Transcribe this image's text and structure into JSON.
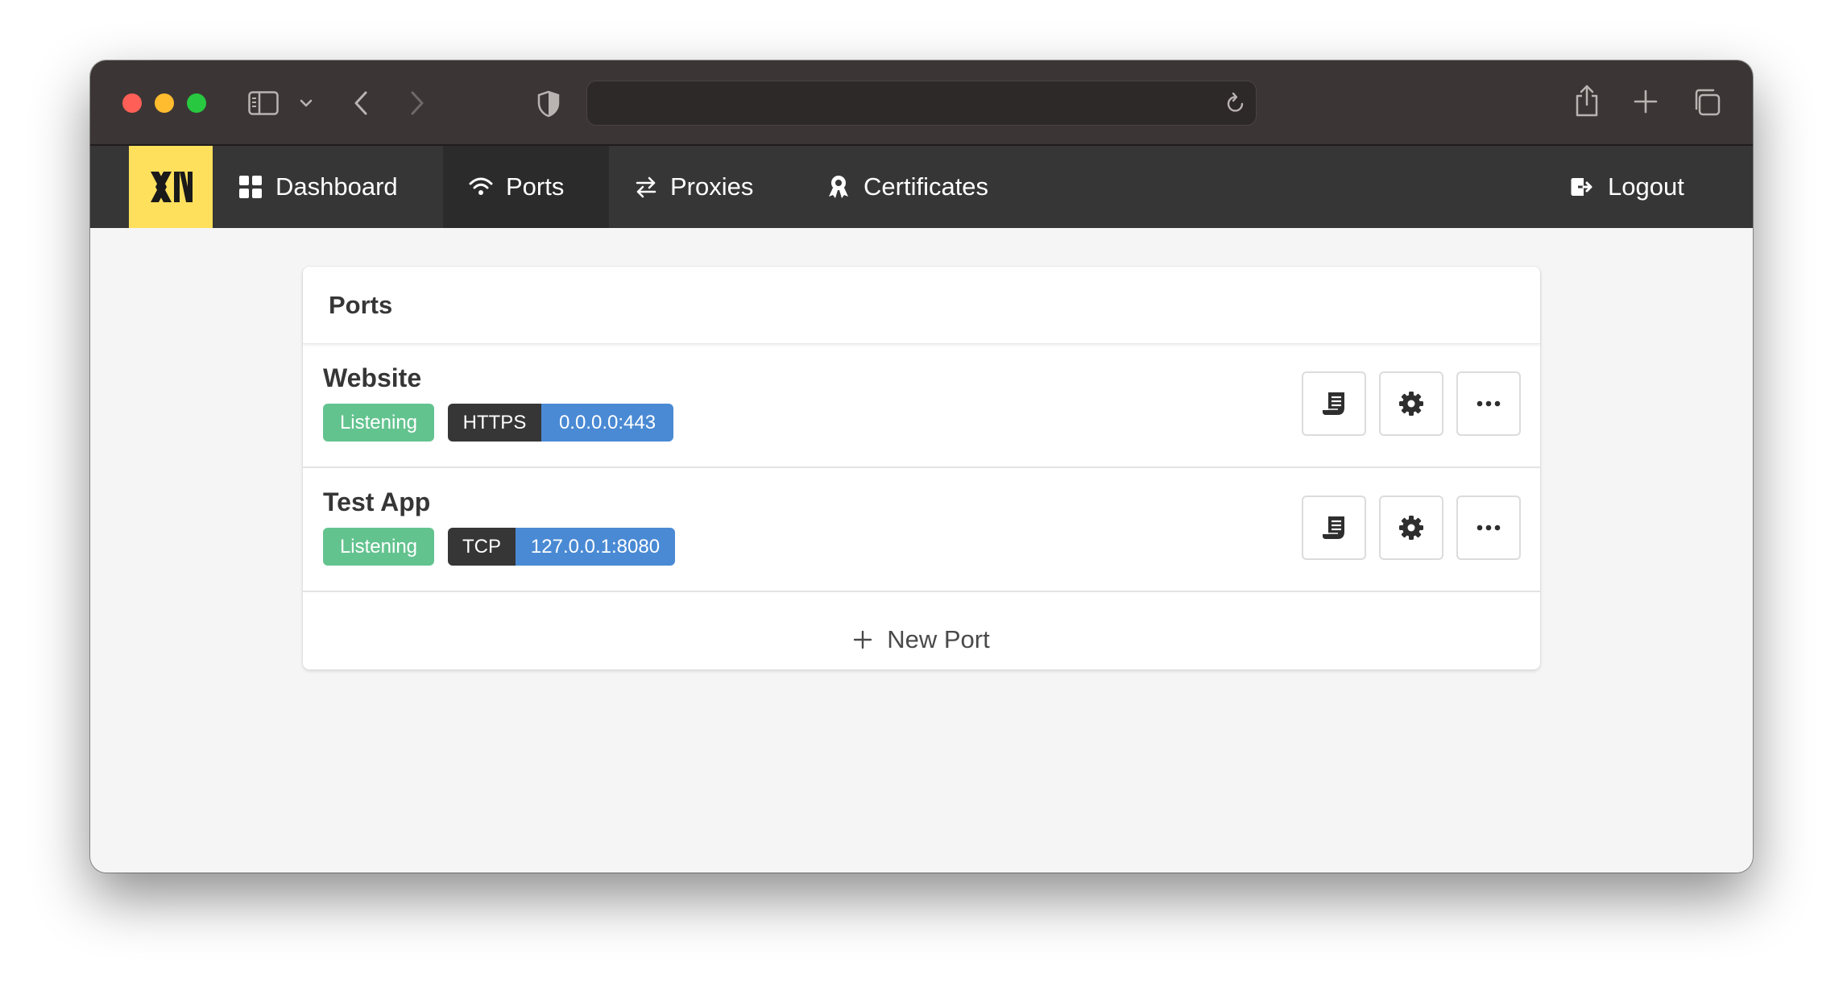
{
  "browser": {
    "address_value": ""
  },
  "nav": {
    "items": [
      {
        "label": "Dashboard",
        "icon": "dashboard-grid-icon"
      },
      {
        "label": "Ports",
        "icon": "wifi-icon",
        "active": true
      },
      {
        "label": "Proxies",
        "icon": "arrows-exchange-icon"
      },
      {
        "label": "Certificates",
        "icon": "certificate-award-icon"
      }
    ],
    "logout_label": "Logout"
  },
  "card": {
    "title": "Ports",
    "ports": [
      {
        "name": "Website",
        "status": "Listening",
        "protocol": "HTTPS",
        "address": "0.0.0.0:443"
      },
      {
        "name": "Test App",
        "status": "Listening",
        "protocol": "TCP",
        "address": "127.0.0.1:8080"
      }
    ],
    "new_port_label": "New Port"
  },
  "colors": {
    "brand": "#ffe05c",
    "navbar": "#363636",
    "listening": "#63c38f",
    "address_tag": "#4a8ad4"
  }
}
